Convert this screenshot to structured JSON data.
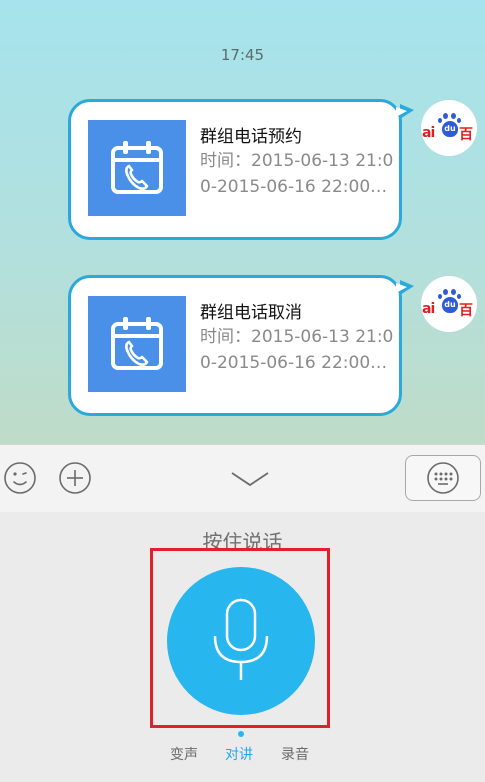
{
  "chat": {
    "timestamp": "17:45",
    "messages": [
      {
        "title": "群组电话预约",
        "body": "时间：2015-06-13 21:00-2015-06-16 22:00…",
        "icon": "calendar-phone-icon",
        "sender_avatar": "baidu-logo"
      },
      {
        "title": "群组电话取消",
        "body": "时间：2015-06-13 21:00-2015-06-16 22:00…",
        "icon": "calendar-phone-icon",
        "sender_avatar": "baidu-logo"
      }
    ],
    "avatar_text": {
      "left": "ai",
      "middle": "du",
      "right": "百"
    }
  },
  "toolbar": {
    "emoji_icon": "smiley-icon",
    "plus_icon": "plus-icon",
    "collapse_icon": "chevron-down-icon",
    "keyboard_icon": "keyboard-icon"
  },
  "voice": {
    "hint": "按住说话",
    "mic_icon": "microphone-icon",
    "tabs": [
      {
        "label": "变声",
        "active": false
      },
      {
        "label": "对讲",
        "active": true
      },
      {
        "label": "录音",
        "active": false
      }
    ]
  },
  "colors": {
    "accent": "#27b6ee",
    "bubble_border": "#2aa9dc",
    "card_icon_bg": "#4a8fe8",
    "highlight": "#e0202d"
  }
}
